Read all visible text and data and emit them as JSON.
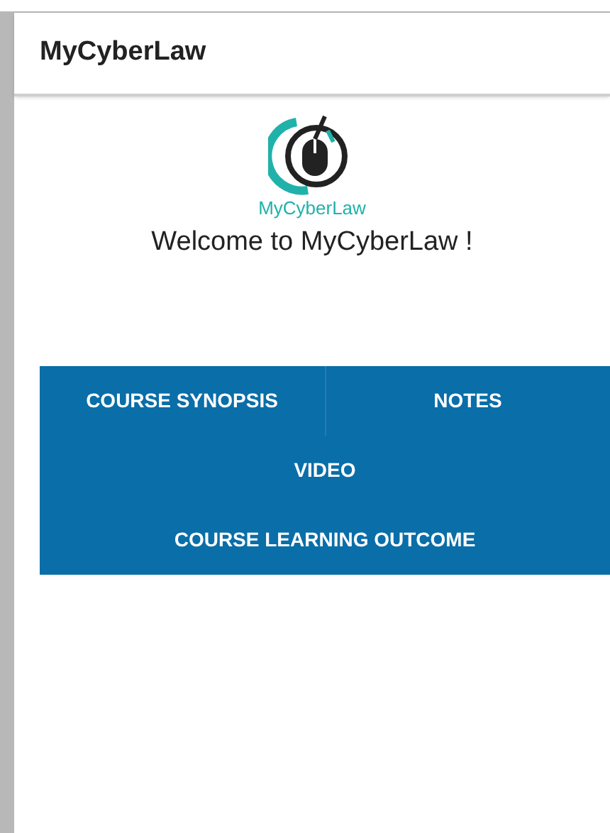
{
  "app_bar": {
    "title": "MyCyberLaw"
  },
  "logo": {
    "text": "MyCyberLaw"
  },
  "welcome": "Welcome to MyCyberLaw !",
  "menu": {
    "rows": [
      [
        "COURSE SYNOPSIS",
        "NOTES"
      ],
      [
        "VIDEO"
      ],
      [
        "COURSE LEARNING OUTCOME"
      ]
    ]
  }
}
